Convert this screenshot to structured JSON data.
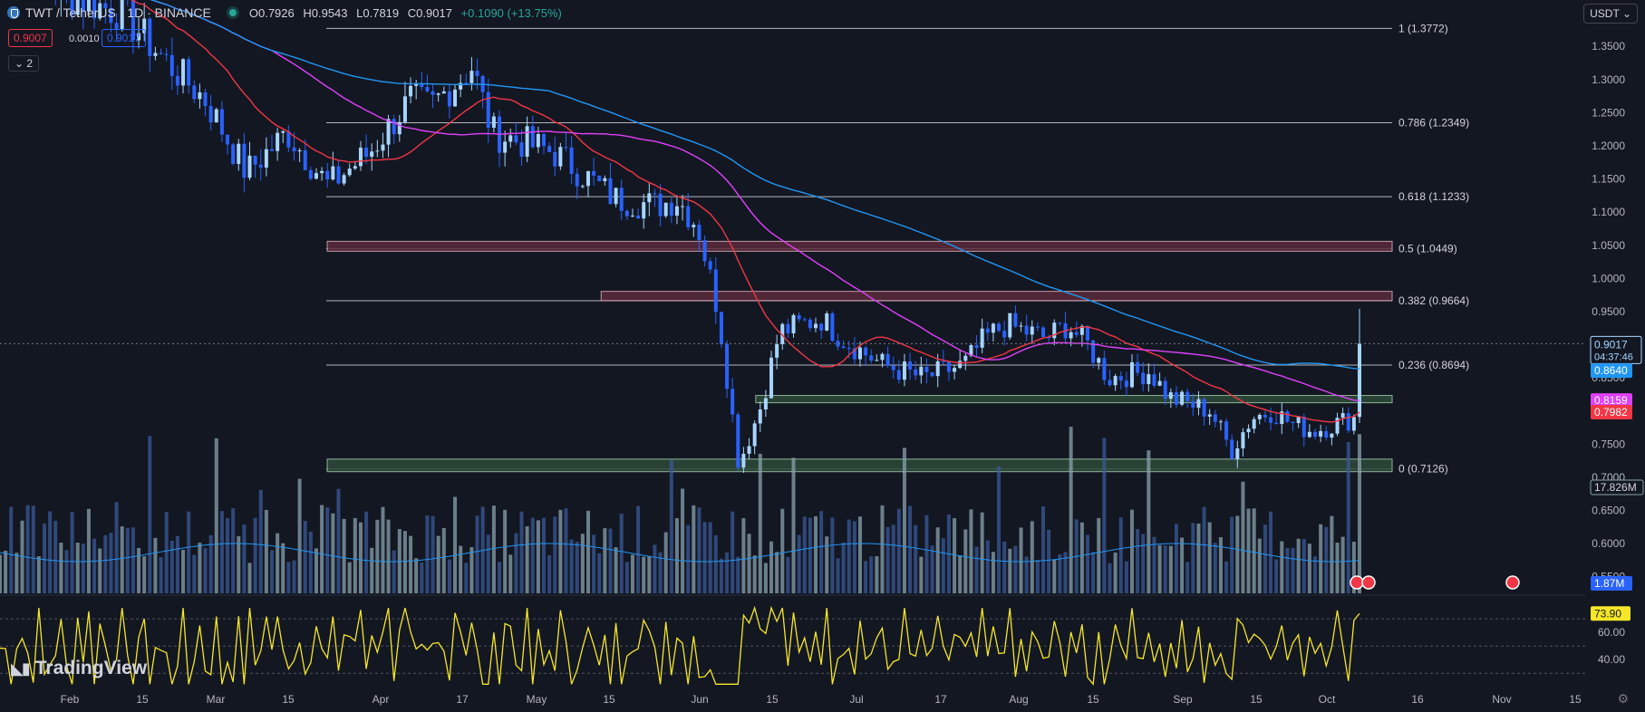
{
  "header": {
    "symbol": "TWT / TetherUS · 1D · BINANCE",
    "open": "O0.7926",
    "high": "H0.9543",
    "low": "L0.7819",
    "close": "C0.9017",
    "change": "+0.1090 (+13.75%)"
  },
  "quote": {
    "sell": "0.9007",
    "spread": "0.0010",
    "buy": "0.9017"
  },
  "indicator_toggle": "2",
  "currency_selector": "USDT",
  "logo_text": "TradingView",
  "chart_data": {
    "type": "candlestick",
    "price_axis": {
      "ticks": [
        1.35,
        1.3,
        1.25,
        1.2,
        1.15,
        1.1,
        1.05,
        1.0,
        0.95,
        0.9,
        0.85,
        0.8,
        0.75,
        0.7,
        0.65,
        0.6,
        0.55
      ],
      "ylim": [
        0.525,
        1.42
      ]
    },
    "time_axis": {
      "labels": [
        "Feb",
        "15",
        "Mar",
        "15",
        "Apr",
        "17",
        "May",
        "15",
        "Jun",
        "15",
        "Jul",
        "17",
        "Aug",
        "15",
        "Sep",
        "15",
        "Oct",
        "16",
        "Nov",
        "15"
      ]
    },
    "fib_levels": [
      {
        "label": "1 (1.3772)",
        "value": 1.3772
      },
      {
        "label": "0.786 (1.2349)",
        "value": 1.2349
      },
      {
        "label": "0.618 (1.1233)",
        "value": 1.1233
      },
      {
        "label": "0.5 (1.0449)",
        "value": 1.0449
      },
      {
        "label": "0.382 (0.9664)",
        "value": 0.9664
      },
      {
        "label": "0.236 (0.8694)",
        "value": 0.8694
      },
      {
        "label": "0 (0.7126)",
        "value": 0.7126
      }
    ],
    "zones": [
      {
        "kind": "resistance",
        "top": 1.056,
        "bottom": 1.041,
        "start": 0.1565
      },
      {
        "kind": "resistance",
        "top": 0.9805,
        "bottom": 0.9665,
        "start": 0.323
      },
      {
        "kind": "support",
        "top": 0.8235,
        "bottom": 0.8125,
        "start": 0.417
      },
      {
        "kind": "support",
        "top": 0.7275,
        "bottom": 0.7085,
        "start": 0.1565
      }
    ],
    "series_waypoints": {
      "close": [
        [
          0,
          1.48
        ],
        [
          0.03,
          1.43
        ],
        [
          0.06,
          1.4
        ],
        [
          0.08,
          1.33
        ],
        [
          0.1,
          1.27
        ],
        [
          0.12,
          1.16
        ],
        [
          0.14,
          1.22
        ],
        [
          0.16,
          1.14
        ],
        [
          0.18,
          1.19
        ],
        [
          0.2,
          1.27
        ],
        [
          0.21,
          1.26
        ],
        [
          0.23,
          1.32
        ],
        [
          0.24,
          1.22
        ],
        [
          0.27,
          1.19
        ],
        [
          0.3,
          1.12
        ],
        [
          0.32,
          1.11
        ],
        [
          0.33,
          1.12
        ],
        [
          0.34,
          1.08
        ],
        [
          0.35,
          0.95
        ],
        [
          0.36,
          0.72
        ],
        [
          0.37,
          0.8
        ],
        [
          0.38,
          0.92
        ],
        [
          0.4,
          0.94
        ],
        [
          0.41,
          0.91
        ],
        [
          0.43,
          0.87
        ],
        [
          0.45,
          0.85
        ],
        [
          0.47,
          0.87
        ],
        [
          0.48,
          0.91
        ],
        [
          0.49,
          0.93
        ],
        [
          0.5,
          0.92
        ],
        [
          0.51,
          0.91
        ],
        [
          0.52,
          0.93
        ],
        [
          0.53,
          0.9
        ],
        [
          0.54,
          0.85
        ],
        [
          0.56,
          0.86
        ],
        [
          0.57,
          0.82
        ],
        [
          0.59,
          0.8
        ],
        [
          0.6,
          0.74
        ],
        [
          0.61,
          0.79
        ],
        [
          0.62,
          0.8
        ],
        [
          0.63,
          0.78
        ],
        [
          0.64,
          0.77
        ],
        [
          0.65,
          0.78
        ],
        [
          0.66,
          0.79
        ],
        [
          0.6625,
          0.9017
        ]
      ],
      "wick": 0.9543,
      "ma_short_last": 0.7982,
      "ma_mid_last": 0.8159,
      "ma_long_last": 0.864
    },
    "last_price_label": {
      "price": "0.9017",
      "countdown": "04:37:46"
    },
    "ma_labels": {
      "long": "0.8640",
      "mid": "0.8159",
      "short": "0.7982"
    },
    "volume": {
      "last_label": "17.826M",
      "ma_label": "1.87M"
    },
    "rsi": {
      "value": "73.90",
      "ticks": [
        "60.00",
        "40.00"
      ],
      "upper": 70,
      "lower": 30,
      "mid": 50
    },
    "colors": {
      "background": "#131722",
      "up": "#a6d5ff",
      "down": "#2962ff",
      "ma_short": "#f23645",
      "ma_mid": "#e040fb",
      "ma_long": "#2196f3",
      "fib": "#b2b5be",
      "resistance_zone": "#5b2a3a",
      "support_zone": "#2f4a3a",
      "rsi": "#f5e628",
      "volume": "#78909c"
    }
  }
}
